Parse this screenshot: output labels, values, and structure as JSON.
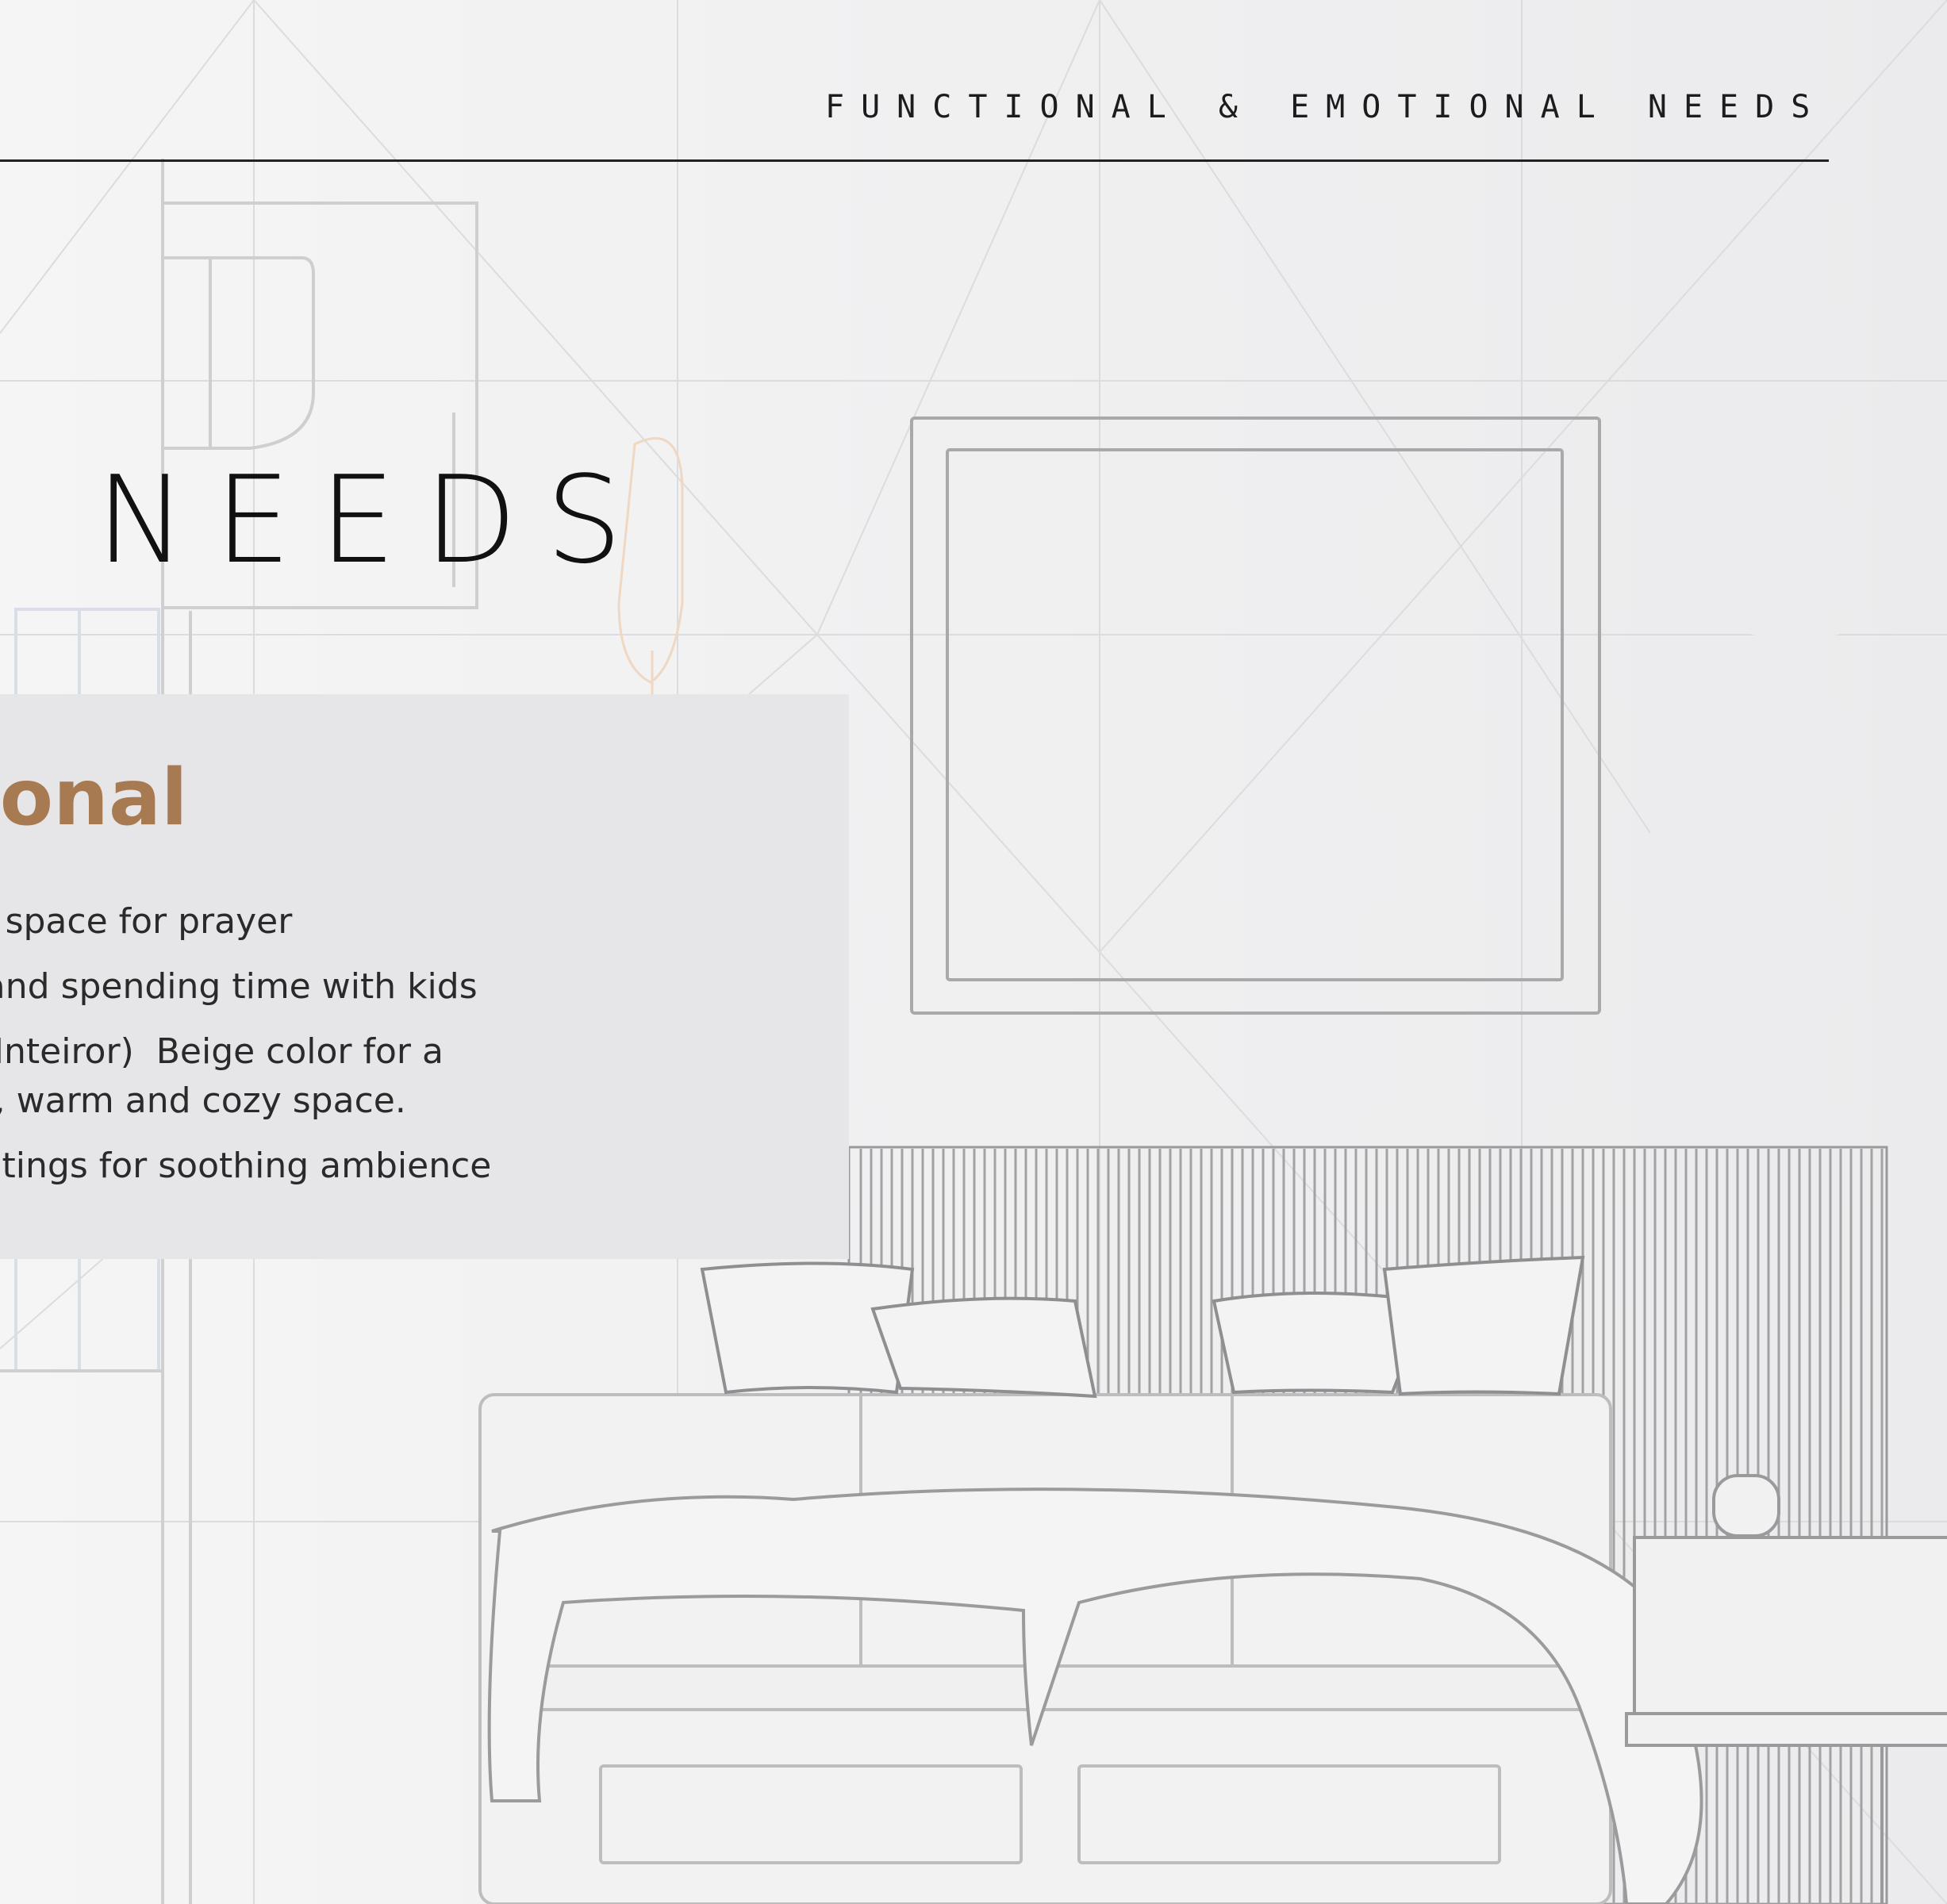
{
  "header": {
    "title": "FUNCTIONAL & EMOTIONAL NEEDS"
  },
  "hero": {
    "title": "L NEEDS"
  },
  "card": {
    "heading": "otional",
    "items": [
      "tive space for prayer",
      "ng and spending time with kids",
      "ndi Inteiror)  Beige color for a\neful, warm and cozy space.",
      "Lightings for soothing ambience"
    ]
  },
  "colors": {
    "accent": "#a87a52",
    "background": "#f0f0f1",
    "card": "#e6e6e8",
    "text": "#1c1c1c"
  }
}
